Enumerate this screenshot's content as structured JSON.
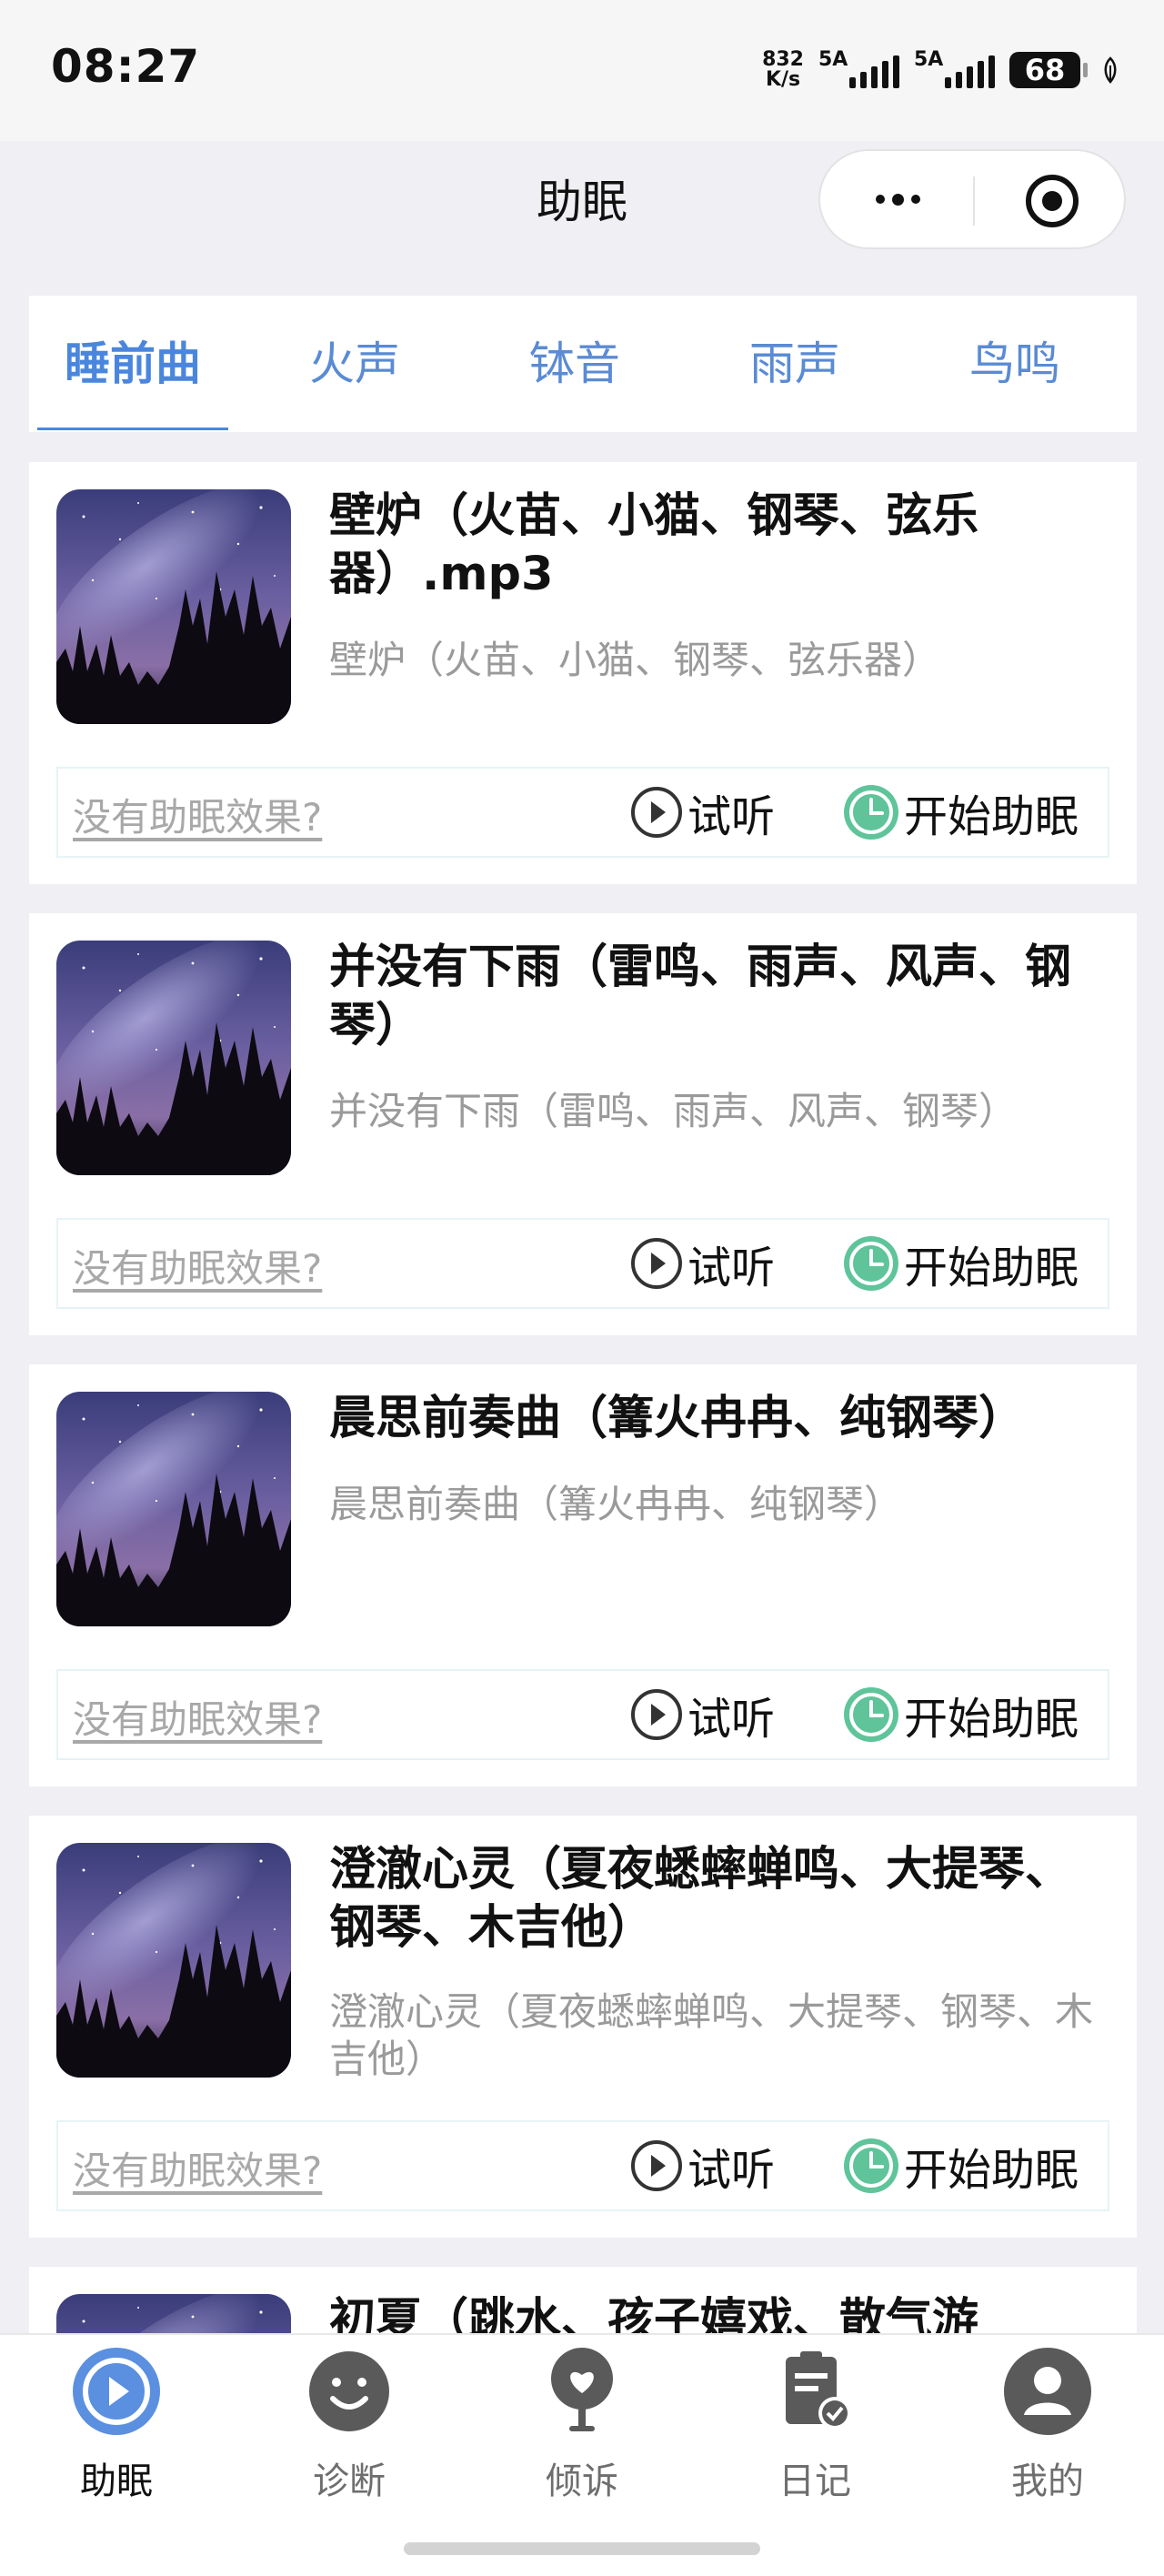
{
  "status_bar": {
    "time": "08:27",
    "net_speed_value": "832",
    "net_speed_unit": "K/s",
    "signal_1_label": "5A",
    "signal_2_label": "5A",
    "battery": "68"
  },
  "nav": {
    "title": "助眠",
    "more_icon": "more-dots-icon",
    "close_icon": "target-circle-icon"
  },
  "tabs": [
    {
      "label": "睡前曲",
      "active": true
    },
    {
      "label": "火声",
      "active": false
    },
    {
      "label": "钵音",
      "active": false
    },
    {
      "label": "雨声",
      "active": false
    },
    {
      "label": "鸟鸣",
      "active": false
    }
  ],
  "cards": [
    {
      "title": "壁炉（火苗、小猫、钢琴、弦乐器）.mp3",
      "subtitle": "壁炉（火苗、小猫、钢琴、弦乐器）",
      "no_effect": "没有助眠效果?",
      "listen": "试听",
      "start": "开始助眠"
    },
    {
      "title": "并没有下雨（雷鸣、雨声、风声、钢琴）",
      "subtitle": "并没有下雨（雷鸣、雨声、风声、钢琴）",
      "no_effect": "没有助眠效果?",
      "listen": "试听",
      "start": "开始助眠"
    },
    {
      "title": "晨思前奏曲（篝火冉冉、纯钢琴）",
      "subtitle": "晨思前奏曲（篝火冉冉、纯钢琴）",
      "no_effect": "没有助眠效果?",
      "listen": "试听",
      "start": "开始助眠"
    },
    {
      "title": "澄澈心灵（夏夜蟋蟀蝉鸣、大提琴、钢琴、木吉他）",
      "subtitle": "澄澈心灵（夏夜蟋蟀蝉鸣、大提琴、钢琴、木吉他）",
      "no_effect": "没有助眠效果?",
      "listen": "试听",
      "start": "开始助眠"
    },
    {
      "title": "初夏（跳水、孩子嬉戏、散气游",
      "subtitle": "",
      "no_effect": "",
      "listen": "",
      "start": ""
    }
  ],
  "tabbar": [
    {
      "label": "助眠",
      "icon": "play-circle-icon",
      "active": true
    },
    {
      "label": "诊断",
      "icon": "smiley-icon",
      "active": false
    },
    {
      "label": "倾诉",
      "icon": "heart-tree-icon",
      "active": false
    },
    {
      "label": "日记",
      "icon": "diary-check-icon",
      "active": false
    },
    {
      "label": "我的",
      "icon": "user-avatar-icon",
      "active": false
    }
  ],
  "colors": {
    "accent": "#4a86dd",
    "start_icon": "#5fc49a",
    "page_bg": "#efeff4"
  }
}
